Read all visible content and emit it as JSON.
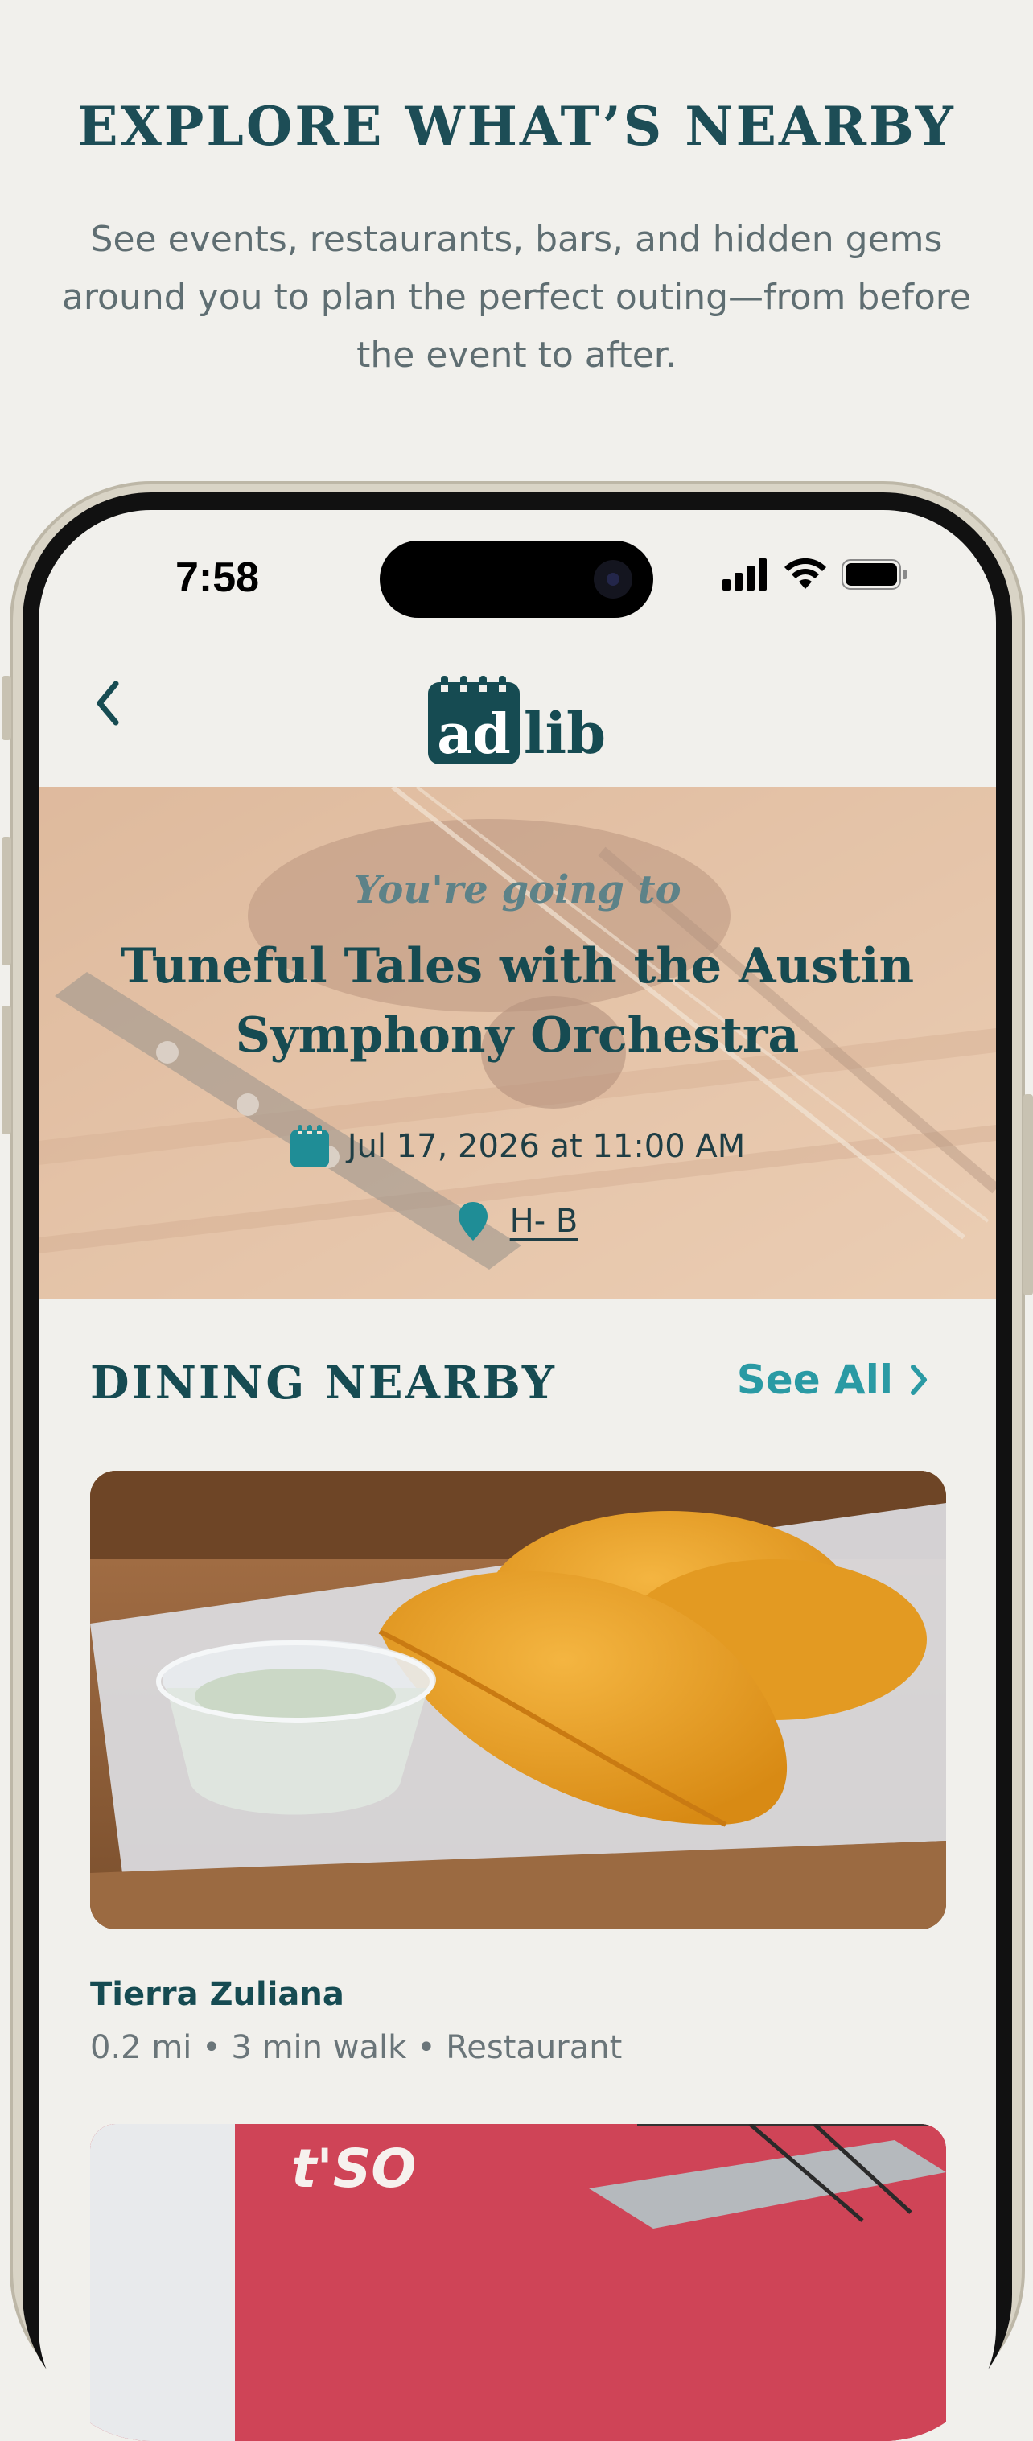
{
  "promo": {
    "title": "EXPLORE WHAT’S NEARBY",
    "subtitle": "See events, restaurants, bars, and hidden gems around you to plan the perfect outing—from before the event to after."
  },
  "status_bar": {
    "time": "7:58",
    "icons": [
      "cellular-signal-icon",
      "wifi-icon",
      "battery-icon"
    ]
  },
  "header": {
    "back_icon": "chevron-left-icon",
    "logo_text_left": "ad",
    "logo_text_right": "lib"
  },
  "event": {
    "kicker": "You're going to",
    "title": "Tuneful Tales with the Austin Symphony Orchestra",
    "date_text": "Jul 17, 2026 at 11:00 AM",
    "venue": "H- B",
    "date_icon": "calendar-icon",
    "venue_icon": "map-pin-icon"
  },
  "dining": {
    "section_title": "DINING NEARBY",
    "see_all_label": "See All",
    "places": [
      {
        "name": "Tierra Zuliana",
        "meta": "0.2 mi • 3 min walk • Restaurant",
        "image": "empanadas-photo"
      },
      {
        "sign_text": "t'SO",
        "image": "storefront-photo"
      }
    ]
  },
  "colors": {
    "background": "#f1f0ec",
    "brand_dark": "#164b52",
    "accent": "#2a9aa4",
    "muted_text": "#6a7579"
  }
}
